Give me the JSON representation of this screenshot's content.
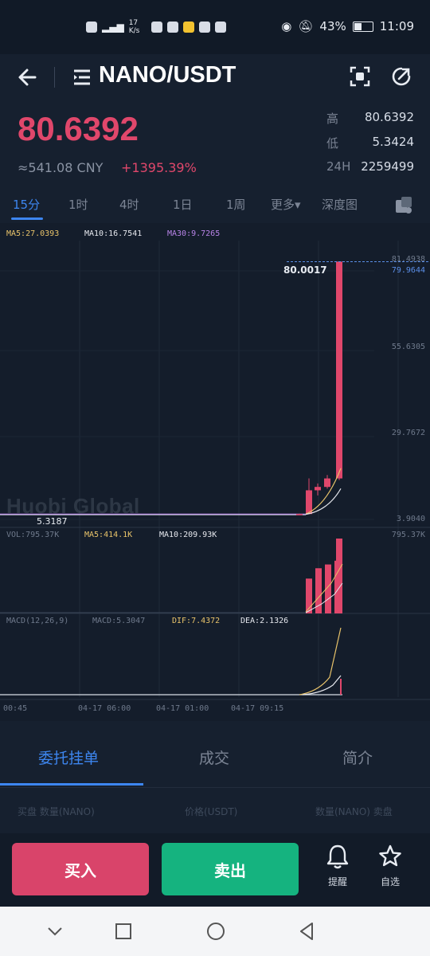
{
  "status_bar": {
    "left_text": "17 K/s",
    "battery": "43%",
    "battery_level": 0.43,
    "time": "11:09"
  },
  "header": {
    "pair": "NANO/USDT"
  },
  "ticker": {
    "last_price": "80.6392",
    "cny_price": "≈541.08 CNY",
    "change": "+1395.39%",
    "stats": [
      {
        "label": "高",
        "value": "80.6392"
      },
      {
        "label": "低",
        "value": "5.3424"
      },
      {
        "label": "24H",
        "value": "2259499"
      }
    ]
  },
  "period_tabs": [
    "15分",
    "1时",
    "4时",
    "1日",
    "1周",
    "更多▾",
    "深度图"
  ],
  "active_period": "15分",
  "chart": {
    "ma_legend": [
      {
        "text": "MA5:27.0393",
        "color": "#e8c36a"
      },
      {
        "text": "MA10:16.7541",
        "color": "#e6e8ee"
      },
      {
        "text": "MA30:9.7265",
        "color": "#b884e8"
      }
    ],
    "y_labels": [
      "81.4938",
      "79.9644",
      "55.6305",
      "29.7672",
      "3.9040"
    ],
    "high_marker": "80.0017",
    "low_marker": "5.3187",
    "watermark": "Huobi Global",
    "vol_legend": [
      {
        "text": "VOL:795.37K",
        "color": "#6f7a8c"
      },
      {
        "text": "MA5:414.1K",
        "color": "#e8c36a"
      },
      {
        "text": "MA10:209.93K",
        "color": "#e6e8ee"
      }
    ],
    "vol_max": "795.37K",
    "macd_legend": [
      {
        "text": "MACD(12,26,9)",
        "color": "#6f7a8c"
      },
      {
        "text": "MACD:5.3047",
        "color": "#6f7a8c"
      },
      {
        "text": "DIF:7.4372",
        "color": "#e8c36a"
      },
      {
        "text": "DEA:2.1326",
        "color": "#e6e8ee"
      }
    ],
    "x_labels": [
      "00:45",
      "04-17 06:00",
      "04-17 01:00",
      "04-17 09:15"
    ],
    "price_candles": [
      {
        "open": 5.4,
        "close": 5.5,
        "low": 5.32,
        "high": 5.6
      },
      {
        "open": 5.5,
        "close": 6.0,
        "low": 5.45,
        "high": 6.2
      },
      {
        "open": 6.0,
        "close": 12.5,
        "low": 5.9,
        "high": 16.0
      },
      {
        "open": 12.5,
        "close": 13.5,
        "low": 11.0,
        "high": 14.5
      },
      {
        "open": 13.5,
        "close": 16.0,
        "low": 13.0,
        "high": 17.0
      },
      {
        "open": 16.0,
        "close": 80.0017,
        "low": 15.5,
        "high": 80.0017
      }
    ],
    "volume_bars": [
      370,
      480,
      520,
      560,
      795.37
    ]
  },
  "order_tabs": [
    "委托挂单",
    "成交",
    "简介"
  ],
  "active_order_tab": "委托挂单",
  "order_columns": [
    "买盘 数量(NANO)",
    "价格(USDT)",
    "数量(NANO) 卖盘"
  ],
  "actions": {
    "buy": "买入",
    "sell": "卖出",
    "alert": "提醒",
    "favorite": "自选"
  },
  "colors": {
    "up": "#e0476b",
    "down": "#15b37f",
    "accent": "#3d86f0"
  }
}
